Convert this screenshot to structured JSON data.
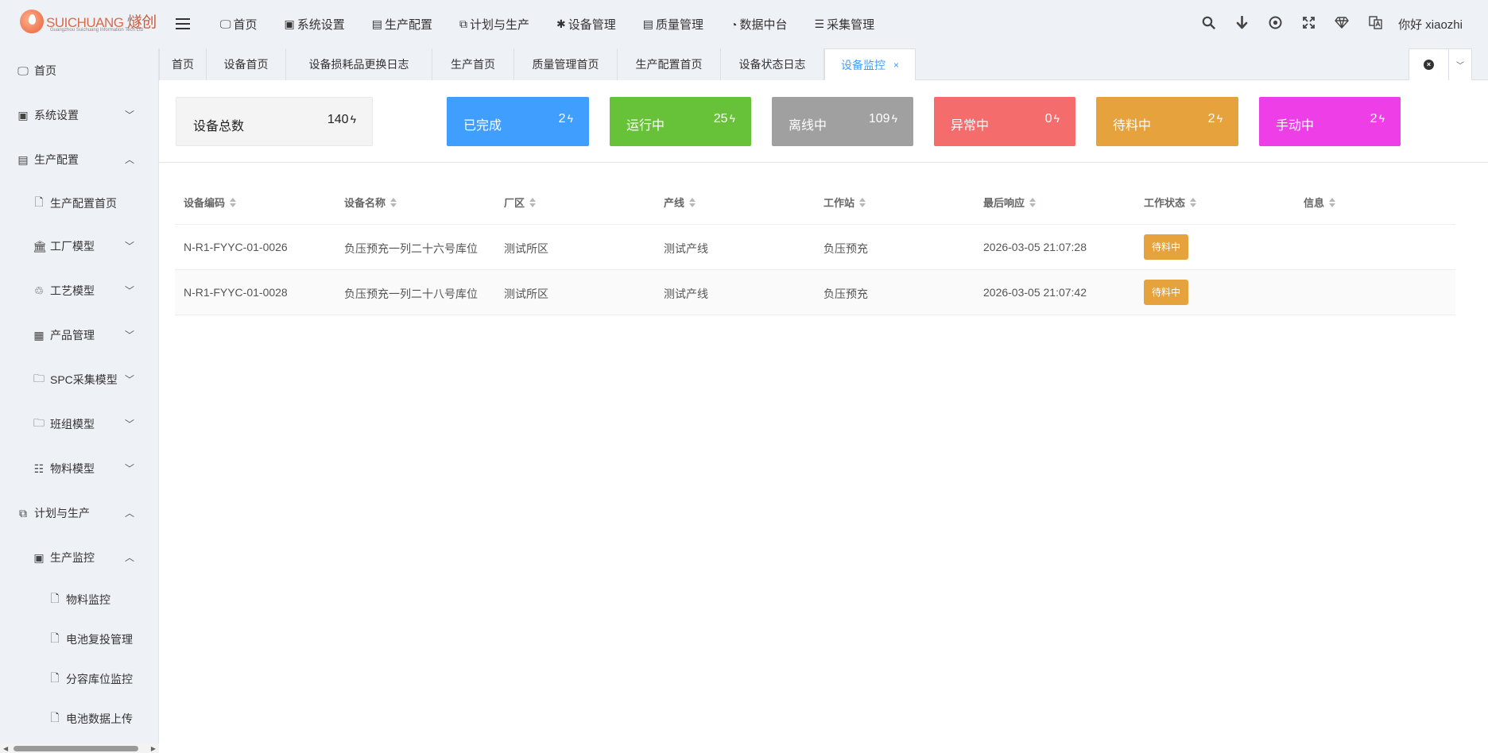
{
  "logo": {
    "brand_en": "SUICHUANG",
    "brand_cn": "燧创",
    "sub": "Guangzhou Suichuang Information Tech Ltd"
  },
  "topnav": [
    {
      "label": "首页",
      "icon": "monitor-icon"
    },
    {
      "label": "系统设置",
      "icon": "user-card-icon"
    },
    {
      "label": "生产配置",
      "icon": "briefcase-icon"
    },
    {
      "label": "计划与生产",
      "icon": "windows-icon"
    },
    {
      "label": "设备管理",
      "icon": "asterisk-icon"
    },
    {
      "label": "质量管理",
      "icon": "briefcase-icon"
    },
    {
      "label": "数据中台",
      "icon": "pie-chart-icon"
    },
    {
      "label": "采集管理",
      "icon": "database-icon"
    }
  ],
  "topright": {
    "user": "你好 xiaozhi"
  },
  "sidebar": {
    "items": [
      {
        "label": "首页"
      },
      {
        "label": "系统设置"
      },
      {
        "label": "生产配置"
      },
      {
        "label": "生产配置首页"
      },
      {
        "label": "工厂模型"
      },
      {
        "label": "工艺模型"
      },
      {
        "label": "产品管理"
      },
      {
        "label": "SPC采集模型"
      },
      {
        "label": "班组模型"
      },
      {
        "label": "物料模型"
      },
      {
        "label": "计划与生产"
      },
      {
        "label": "生产监控"
      },
      {
        "label": "物料监控"
      },
      {
        "label": "电池复投管理"
      },
      {
        "label": "分容库位监控"
      },
      {
        "label": "电池数据上传"
      }
    ]
  },
  "tabs": [
    {
      "label": "首页"
    },
    {
      "label": "设备首页"
    },
    {
      "label": "设备损耗品更换日志"
    },
    {
      "label": "生产首页"
    },
    {
      "label": "质量管理首页"
    },
    {
      "label": "生产配置首页"
    },
    {
      "label": "设备状态日志"
    },
    {
      "label": "设备监控",
      "close": "×"
    }
  ],
  "stats": [
    {
      "label": "设备总数",
      "value": "140",
      "color": "#f4f4f5"
    },
    {
      "label": "已完成",
      "value": "2",
      "color": "#409eff"
    },
    {
      "label": "运行中",
      "value": "25",
      "color": "#67c23a"
    },
    {
      "label": "离线中",
      "value": "109",
      "color": "#a0a0a0"
    },
    {
      "label": "异常中",
      "value": "0",
      "color": "#f56c6c"
    },
    {
      "label": "待料中",
      "value": "2",
      "color": "#e6a23c"
    },
    {
      "label": "手动中",
      "value": "2",
      "color": "#ee3ee8"
    }
  ],
  "table": {
    "columns": [
      "设备编码",
      "设备名称",
      "厂区",
      "产线",
      "工作站",
      "最后响应",
      "工作状态",
      "信息"
    ],
    "rows": [
      {
        "code": "N-R1-FYYC-01-0026",
        "name": "负压预充一列二十六号库位",
        "factory": "测试所区",
        "line": "测试产线",
        "station": "负压预充",
        "time": "2026-03-05 21:07:28",
        "status": "待料中",
        "info": ""
      },
      {
        "code": "N-R1-FYYC-01-0028",
        "name": "负压预充一列二十八号库位",
        "factory": "测试所区",
        "line": "测试产线",
        "station": "负压预充",
        "time": "2026-03-05 21:07:42",
        "status": "待料中",
        "info": ""
      }
    ]
  },
  "colors": {
    "accent": "#409eff",
    "pending": "#e6a23c"
  }
}
